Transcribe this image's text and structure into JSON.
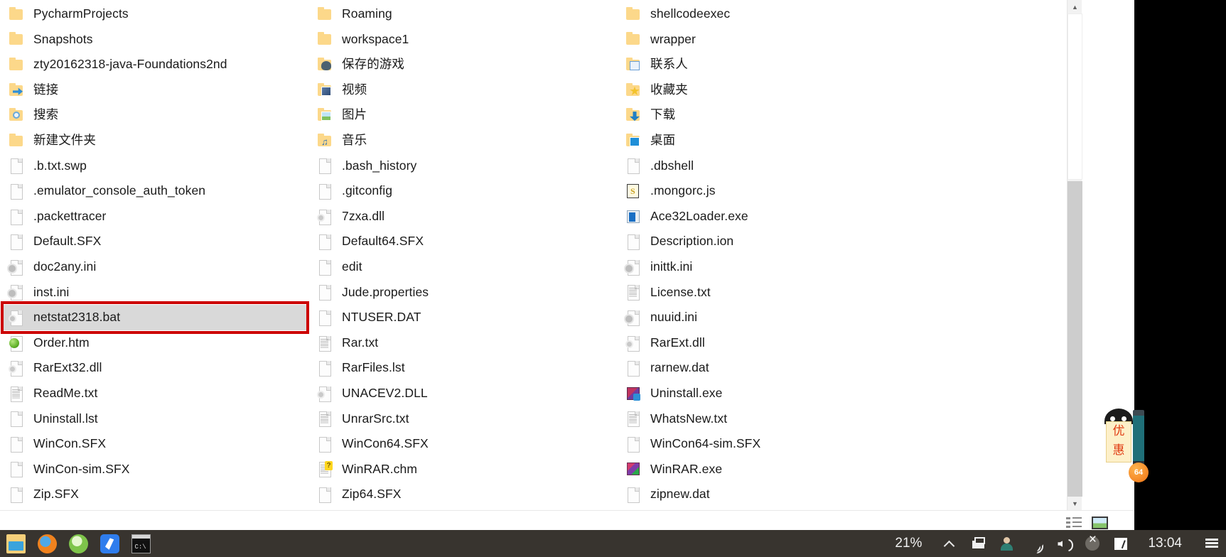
{
  "window": {
    "kind": "file-explorer-list-view"
  },
  "file_list": {
    "columns": [
      {
        "items": [
          {
            "name": "PycharmProjects",
            "icon": "folder-icon",
            "selected": false
          },
          {
            "name": "Snapshots",
            "icon": "folder-icon",
            "selected": false
          },
          {
            "name": "zty20162318-java-Foundations2nd",
            "icon": "folder-icon",
            "selected": false
          },
          {
            "name": "链接",
            "icon": "folder-links-icon",
            "selected": false,
            "cjk": true
          },
          {
            "name": "搜索",
            "icon": "folder-searches-icon",
            "selected": false,
            "cjk": true
          },
          {
            "name": "新建文件夹",
            "icon": "folder-icon",
            "selected": false,
            "cjk": true
          },
          {
            "name": ".b.txt.swp",
            "icon": "file-blank-icon",
            "selected": false
          },
          {
            "name": ".emulator_console_auth_token",
            "icon": "file-blank-icon",
            "selected": false
          },
          {
            "name": ".packettracer",
            "icon": "file-blank-icon",
            "selected": false
          },
          {
            "name": "Default.SFX",
            "icon": "file-blank-icon",
            "selected": false
          },
          {
            "name": "doc2any.ini",
            "icon": "file-ini-icon",
            "selected": false
          },
          {
            "name": "inst.ini",
            "icon": "file-ini-icon",
            "selected": false
          },
          {
            "name": "netstat2318.bat",
            "icon": "file-bat-icon",
            "selected": true
          },
          {
            "name": "Order.htm",
            "icon": "file-htm-icon",
            "selected": false
          },
          {
            "name": "RarExt32.dll",
            "icon": "file-dll-icon",
            "selected": false
          },
          {
            "name": "ReadMe.txt",
            "icon": "file-txt-icon",
            "selected": false
          },
          {
            "name": "Uninstall.lst",
            "icon": "file-blank-icon",
            "selected": false
          },
          {
            "name": "WinCon.SFX",
            "icon": "file-blank-icon",
            "selected": false
          },
          {
            "name": "WinCon-sim.SFX",
            "icon": "file-blank-icon",
            "selected": false
          },
          {
            "name": "Zip.SFX",
            "icon": "file-blank-icon",
            "selected": false
          }
        ]
      },
      {
        "items": [
          {
            "name": "Roaming",
            "icon": "folder-icon",
            "selected": false
          },
          {
            "name": "workspace1",
            "icon": "folder-icon",
            "selected": false
          },
          {
            "name": "保存的游戏",
            "icon": "folder-saved-games-icon",
            "selected": false,
            "cjk": true
          },
          {
            "name": "视频",
            "icon": "folder-videos-icon",
            "selected": false,
            "cjk": true
          },
          {
            "name": "图片",
            "icon": "folder-pictures-icon",
            "selected": false,
            "cjk": true
          },
          {
            "name": "音乐",
            "icon": "folder-music-icon",
            "selected": false,
            "cjk": true
          },
          {
            "name": ".bash_history",
            "icon": "file-blank-icon",
            "selected": false
          },
          {
            "name": ".gitconfig",
            "icon": "file-blank-icon",
            "selected": false
          },
          {
            "name": "7zxa.dll",
            "icon": "file-dll-icon",
            "selected": false
          },
          {
            "name": "Default64.SFX",
            "icon": "file-blank-icon",
            "selected": false
          },
          {
            "name": "edit",
            "icon": "file-blank-icon",
            "selected": false
          },
          {
            "name": "Jude.properties",
            "icon": "file-blank-icon",
            "selected": false
          },
          {
            "name": "NTUSER.DAT",
            "icon": "file-blank-icon",
            "selected": false
          },
          {
            "name": "Rar.txt",
            "icon": "file-txt-icon",
            "selected": false
          },
          {
            "name": "RarFiles.lst",
            "icon": "file-blank-icon",
            "selected": false
          },
          {
            "name": "UNACEV2.DLL",
            "icon": "file-dll-icon",
            "selected": false
          },
          {
            "name": "UnrarSrc.txt",
            "icon": "file-txt-icon",
            "selected": false
          },
          {
            "name": "WinCon64.SFX",
            "icon": "file-blank-icon",
            "selected": false
          },
          {
            "name": "WinRAR.chm",
            "icon": "file-chm-icon",
            "selected": false
          },
          {
            "name": "Zip64.SFX",
            "icon": "file-blank-icon",
            "selected": false
          }
        ]
      },
      {
        "items": [
          {
            "name": "shellcodeexec",
            "icon": "folder-icon",
            "selected": false
          },
          {
            "name": "wrapper",
            "icon": "folder-icon",
            "selected": false
          },
          {
            "name": "联系人",
            "icon": "folder-contacts-icon",
            "selected": false,
            "cjk": true
          },
          {
            "name": "收藏夹",
            "icon": "folder-favorites-icon",
            "selected": false,
            "cjk": true
          },
          {
            "name": "下载",
            "icon": "folder-downloads-icon",
            "selected": false,
            "cjk": true
          },
          {
            "name": "桌面",
            "icon": "folder-desktop-icon",
            "selected": false,
            "cjk": true
          },
          {
            "name": ".dbshell",
            "icon": "file-blank-icon",
            "selected": false
          },
          {
            "name": ".mongorc.js",
            "icon": "file-js-icon",
            "selected": false
          },
          {
            "name": "Ace32Loader.exe",
            "icon": "file-exe-blue-icon",
            "selected": false
          },
          {
            "name": "Description.ion",
            "icon": "file-blank-icon",
            "selected": false
          },
          {
            "name": "inittk.ini",
            "icon": "file-ini-icon",
            "selected": false
          },
          {
            "name": "License.txt",
            "icon": "file-txt-icon",
            "selected": false
          },
          {
            "name": "nuuid.ini",
            "icon": "file-ini-icon",
            "selected": false
          },
          {
            "name": "RarExt.dll",
            "icon": "file-dll-icon",
            "selected": false
          },
          {
            "name": "rarnew.dat",
            "icon": "file-blank-icon",
            "selected": false
          },
          {
            "name": "Uninstall.exe",
            "icon": "file-winrar-uninstall-icon",
            "selected": false
          },
          {
            "name": "WhatsNew.txt",
            "icon": "file-txt-icon",
            "selected": false
          },
          {
            "name": "WinCon64-sim.SFX",
            "icon": "file-blank-icon",
            "selected": false
          },
          {
            "name": "WinRAR.exe",
            "icon": "file-winrar-icon",
            "selected": false
          },
          {
            "name": "zipnew.dat",
            "icon": "file-blank-icon",
            "selected": false
          }
        ]
      }
    ]
  },
  "annotation": {
    "highlight_target": "netstat2318.bat",
    "box_color": "#cc0000"
  },
  "scrollbar": {
    "up_arrow": "▲",
    "down_arrow": "▼"
  },
  "status_bar": {
    "view_details_label": "Details view",
    "view_icons_label": "Large icons view"
  },
  "coupon_widget": {
    "line1": "优",
    "line2": "惠",
    "badge": "64"
  },
  "taskbar": {
    "pinned": [
      {
        "name": "file-explorer-icon"
      },
      {
        "name": "firefox-icon"
      },
      {
        "name": "green-browser-icon"
      },
      {
        "name": "editor-icon"
      },
      {
        "name": "terminal-icon"
      }
    ],
    "battery_percent": "21%",
    "clock": "13:04",
    "tray": [
      {
        "name": "show-hidden-icons-chevron-icon"
      },
      {
        "name": "printer-icon"
      },
      {
        "name": "user-account-icon"
      },
      {
        "name": "network-wifi-icon"
      },
      {
        "name": "volume-speaker-icon"
      },
      {
        "name": "blocked-status-icon"
      },
      {
        "name": "security-check-icon"
      }
    ],
    "action_center": "notifications-icon"
  }
}
